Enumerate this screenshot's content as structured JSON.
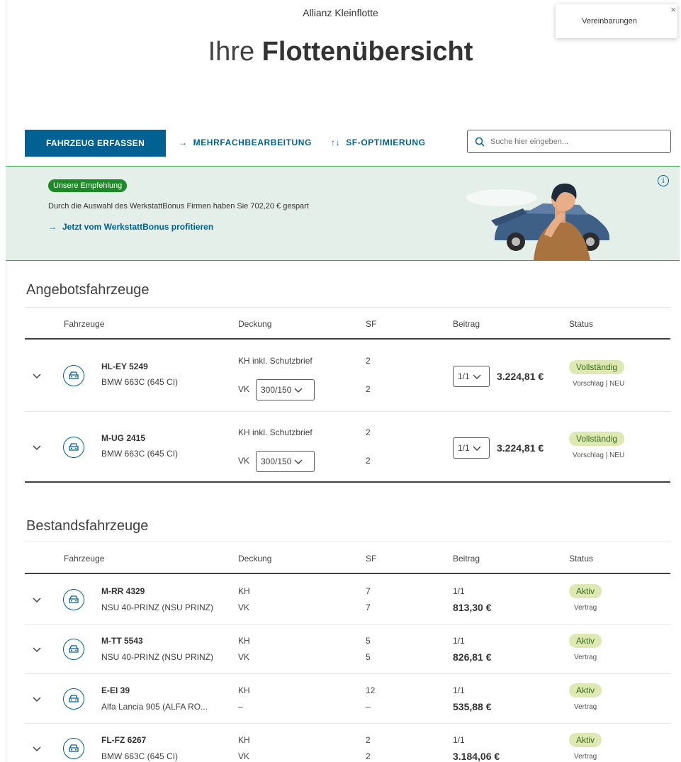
{
  "app_title": "Allianz Kleinflotte",
  "popup": {
    "label": "Vereinbarungen",
    "close": "×"
  },
  "page_title": {
    "light": "Ihre ",
    "bold": "Flottenübersicht"
  },
  "toolbar": {
    "primary_button": "FAHRZEUG ERFASSEN",
    "multi_edit": "MEHRFACHBEARBEITUNG",
    "sf_opt": "SF-OPTIMIERUNG",
    "search_placeholder": "Suche hier eingeben..."
  },
  "banner": {
    "badge": "Unsere Empfehlung",
    "text": "Durch die Auswahl des WerkstattBonus Firmen haben Sie 702,20 € gespart",
    "link": "Jetzt vom WerkstattBonus profitieren",
    "info": "i"
  },
  "columns": {
    "fahrzeuge": "Fahrzeuge",
    "deckung": "Deckung",
    "sf": "SF",
    "beitrag": "Beitrag",
    "status": "Status"
  },
  "angebot": {
    "title": "Angebotsfahrzeuge",
    "rows": [
      {
        "plate": "HL-EY 5249",
        "model": "BMW 663C (645 CI)",
        "deckung1": "KH inkl. Schutzbrief",
        "vk_label": "VK",
        "vk_value": "300/150",
        "sf1": "2",
        "sf2": "2",
        "rate": "1/1",
        "price": "3.224,81 €",
        "status": "Vollständig",
        "status_sub": "Vorschlag | NEU"
      },
      {
        "plate": "M-UG 2415",
        "model": "BMW 663C (645 CI)",
        "deckung1": "KH inkl. Schutzbrief",
        "vk_label": "VK",
        "vk_value": "300/150",
        "sf1": "2",
        "sf2": "2",
        "rate": "1/1",
        "price": "3.224,81 €",
        "status": "Vollständig",
        "status_sub": "Vorschlag | NEU"
      }
    ]
  },
  "bestand": {
    "title": "Bestandsfahrzeuge",
    "rows": [
      {
        "plate": "M-RR 4329",
        "model": "NSU 40-PRINZ (NSU PRINZ)",
        "d1": "KH",
        "d2": "VK",
        "sf1": "7",
        "sf2": "7",
        "rate": "1/1",
        "price": "813,30 €",
        "status": "Aktiv",
        "status_sub": "Vertrag"
      },
      {
        "plate": "M-TT 5543",
        "model": "NSU 40-PRINZ (NSU PRINZ)",
        "d1": "KH",
        "d2": "VK",
        "sf1": "5",
        "sf2": "5",
        "rate": "1/1",
        "price": "826,81 €",
        "status": "Aktiv",
        "status_sub": "Vertrag"
      },
      {
        "plate": "E-EI 39",
        "model": "Alfa Lancia 905 (ALFA RO...",
        "d1": "KH",
        "d2": "–",
        "sf1": "12",
        "sf2": "–",
        "rate": "1/1",
        "price": "535,88 €",
        "status": "Aktiv",
        "status_sub": "Vertrag"
      },
      {
        "plate": "FL-FZ 6267",
        "model": "BMW 663C (645 CI)",
        "d1": "KH",
        "d2": "VK",
        "sf1": "2",
        "sf2": "2",
        "rate": "1/1",
        "price": "3.184,06 €",
        "status": "Aktiv",
        "status_sub": "Vertrag"
      }
    ]
  },
  "colors": {
    "primary": "#006192",
    "green": "#1e8927",
    "banner_bg": "#e3efe8",
    "status_bg": "#dde8b3"
  }
}
